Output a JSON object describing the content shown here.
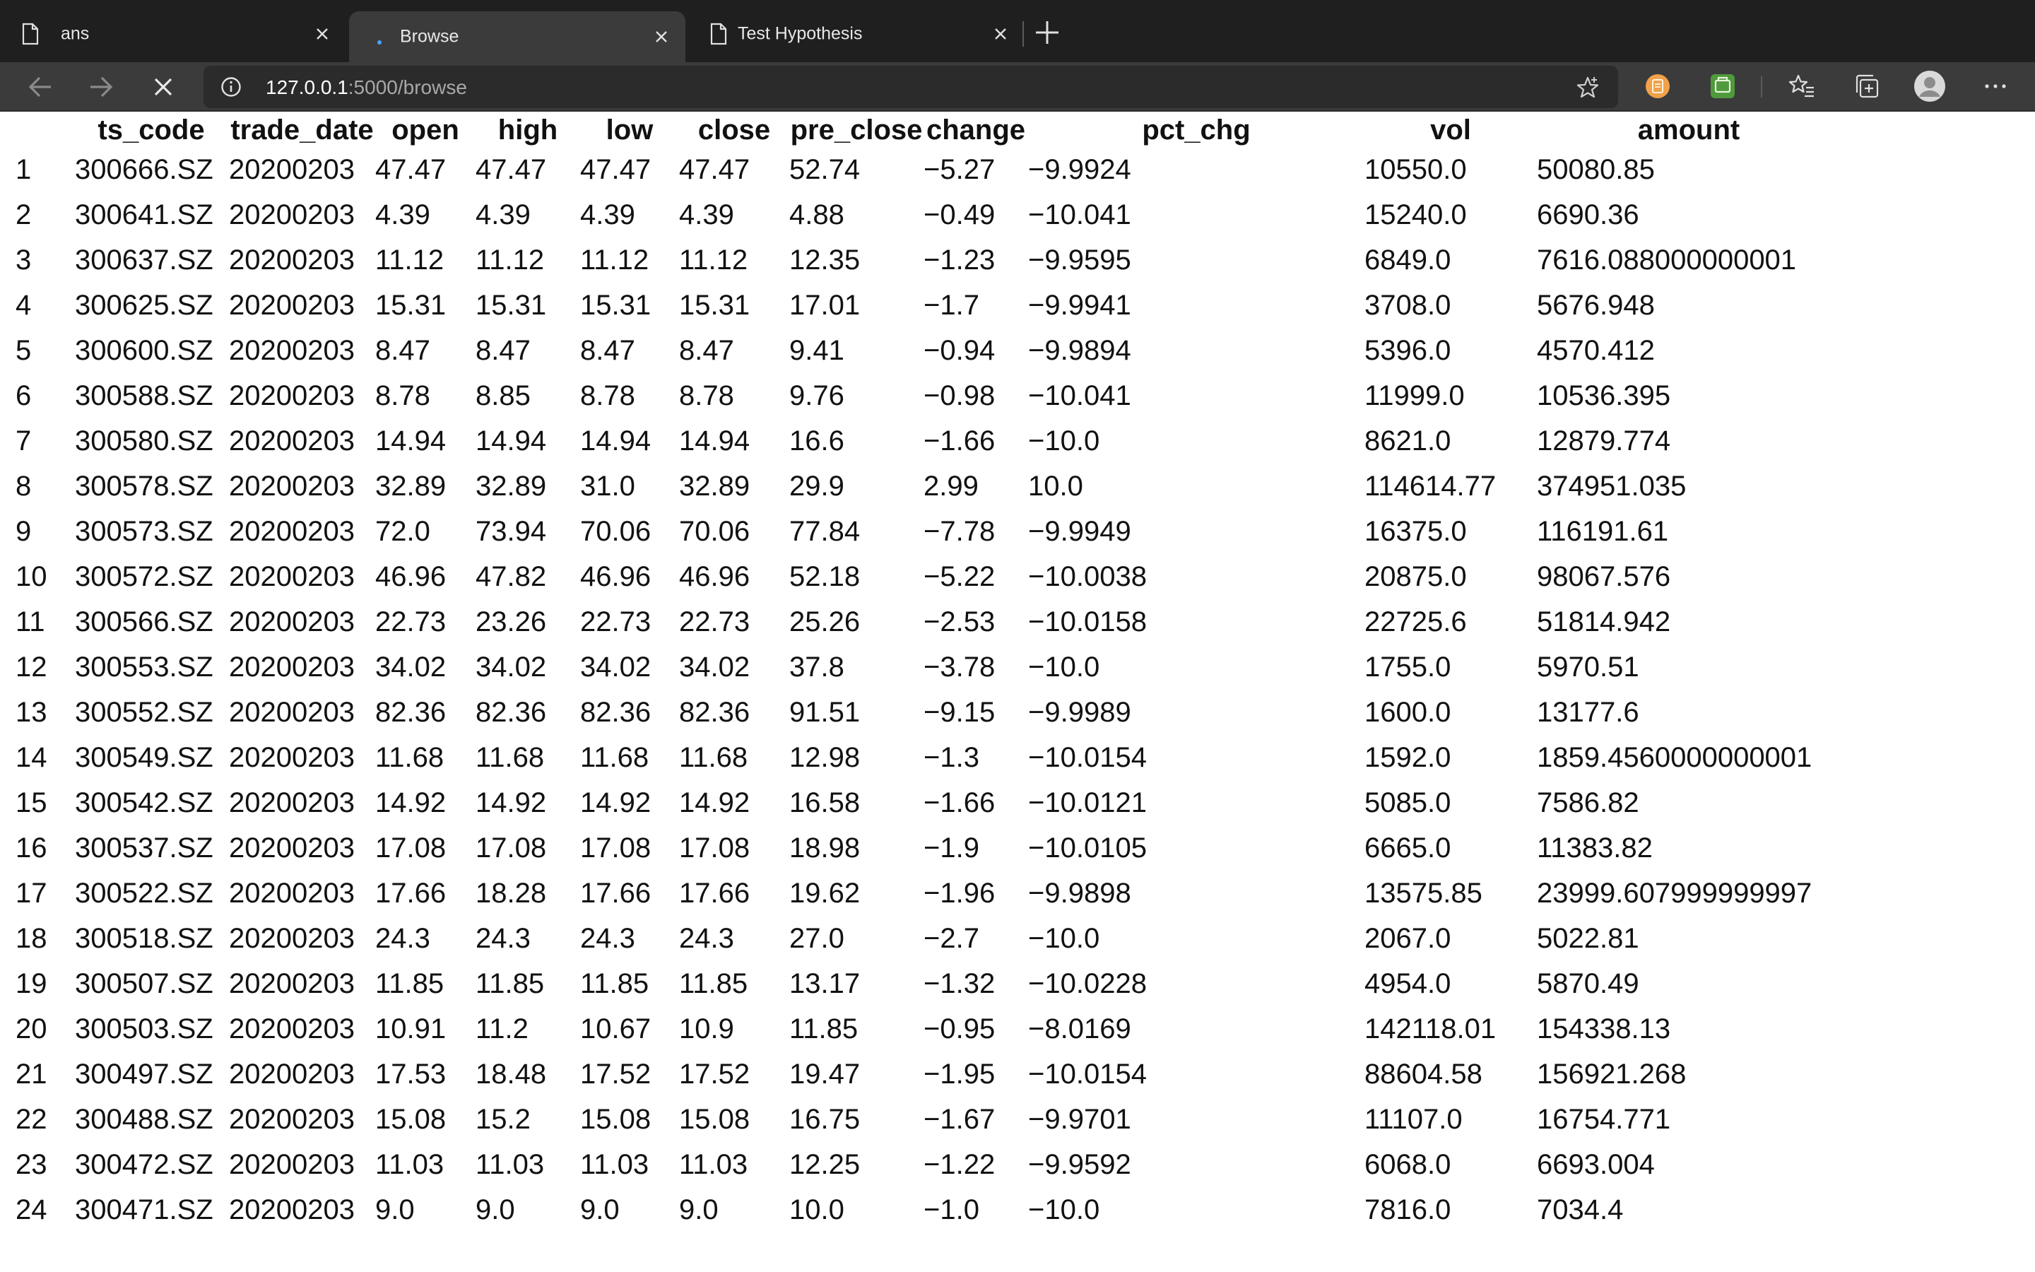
{
  "browser": {
    "tabs": [
      {
        "title": "ans",
        "active": false
      },
      {
        "title": "Browse",
        "active": true,
        "loading": true
      },
      {
        "title": "Test Hypothesis",
        "active": false
      }
    ],
    "address": {
      "host": "127.0.0.1",
      "rest": ":5000/browse"
    },
    "icons": [
      "back-icon",
      "forward-icon",
      "stop-loading-icon",
      "site-info-icon",
      "favorite-star-icon",
      "extension-orange-icon",
      "extension-green-icon",
      "favorites-icon",
      "collections-icon",
      "profile-avatar-icon",
      "more-menu-icon"
    ],
    "colors": {
      "tabstrip": "#1f1f1f",
      "toolbar": "#3b3b3b",
      "address_bg": "#2b2b2b"
    }
  },
  "table": {
    "columns": [
      "",
      "ts_code",
      "trade_date",
      "open",
      "high",
      "low",
      "close",
      "pre_close",
      "change",
      "pct_chg",
      "vol",
      "amount"
    ],
    "rows": [
      [
        "1",
        "300666.SZ",
        "20200203",
        "47.47",
        "47.47",
        "47.47",
        "47.47",
        "52.74",
        "−5.27",
        "−9.9924",
        "10550.0",
        "50080.85"
      ],
      [
        "2",
        "300641.SZ",
        "20200203",
        "4.39",
        "4.39",
        "4.39",
        "4.39",
        "4.88",
        "−0.49",
        "−10.041",
        "15240.0",
        "6690.36"
      ],
      [
        "3",
        "300637.SZ",
        "20200203",
        "11.12",
        "11.12",
        "11.12",
        "11.12",
        "12.35",
        "−1.23",
        "−9.9595",
        "6849.0",
        "7616.088000000001"
      ],
      [
        "4",
        "300625.SZ",
        "20200203",
        "15.31",
        "15.31",
        "15.31",
        "15.31",
        "17.01",
        "−1.7",
        "−9.9941",
        "3708.0",
        "5676.948"
      ],
      [
        "5",
        "300600.SZ",
        "20200203",
        "8.47",
        "8.47",
        "8.47",
        "8.47",
        "9.41",
        "−0.94",
        "−9.9894",
        "5396.0",
        "4570.412"
      ],
      [
        "6",
        "300588.SZ",
        "20200203",
        "8.78",
        "8.85",
        "8.78",
        "8.78",
        "9.76",
        "−0.98",
        "−10.041",
        "11999.0",
        "10536.395"
      ],
      [
        "7",
        "300580.SZ",
        "20200203",
        "14.94",
        "14.94",
        "14.94",
        "14.94",
        "16.6",
        "−1.66",
        "−10.0",
        "8621.0",
        "12879.774"
      ],
      [
        "8",
        "300578.SZ",
        "20200203",
        "32.89",
        "32.89",
        "31.0",
        "32.89",
        "29.9",
        "2.99",
        "10.0",
        "114614.77",
        "374951.035"
      ],
      [
        "9",
        "300573.SZ",
        "20200203",
        "72.0",
        "73.94",
        "70.06",
        "70.06",
        "77.84",
        "−7.78",
        "−9.9949",
        "16375.0",
        "116191.61"
      ],
      [
        "10",
        "300572.SZ",
        "20200203",
        "46.96",
        "47.82",
        "46.96",
        "46.96",
        "52.18",
        "−5.22",
        "−10.0038",
        "20875.0",
        "98067.576"
      ],
      [
        "11",
        "300566.SZ",
        "20200203",
        "22.73",
        "23.26",
        "22.73",
        "22.73",
        "25.26",
        "−2.53",
        "−10.0158",
        "22725.6",
        "51814.942"
      ],
      [
        "12",
        "300553.SZ",
        "20200203",
        "34.02",
        "34.02",
        "34.02",
        "34.02",
        "37.8",
        "−3.78",
        "−10.0",
        "1755.0",
        "5970.51"
      ],
      [
        "13",
        "300552.SZ",
        "20200203",
        "82.36",
        "82.36",
        "82.36",
        "82.36",
        "91.51",
        "−9.15",
        "−9.9989",
        "1600.0",
        "13177.6"
      ],
      [
        "14",
        "300549.SZ",
        "20200203",
        "11.68",
        "11.68",
        "11.68",
        "11.68",
        "12.98",
        "−1.3",
        "−10.0154",
        "1592.0",
        "1859.4560000000001"
      ],
      [
        "15",
        "300542.SZ",
        "20200203",
        "14.92",
        "14.92",
        "14.92",
        "14.92",
        "16.58",
        "−1.66",
        "−10.0121",
        "5085.0",
        "7586.82"
      ],
      [
        "16",
        "300537.SZ",
        "20200203",
        "17.08",
        "17.08",
        "17.08",
        "17.08",
        "18.98",
        "−1.9",
        "−10.0105",
        "6665.0",
        "11383.82"
      ],
      [
        "17",
        "300522.SZ",
        "20200203",
        "17.66",
        "18.28",
        "17.66",
        "17.66",
        "19.62",
        "−1.96",
        "−9.9898",
        "13575.85",
        "23999.607999999997"
      ],
      [
        "18",
        "300518.SZ",
        "20200203",
        "24.3",
        "24.3",
        "24.3",
        "24.3",
        "27.0",
        "−2.7",
        "−10.0",
        "2067.0",
        "5022.81"
      ],
      [
        "19",
        "300507.SZ",
        "20200203",
        "11.85",
        "11.85",
        "11.85",
        "11.85",
        "13.17",
        "−1.32",
        "−10.0228",
        "4954.0",
        "5870.49"
      ],
      [
        "20",
        "300503.SZ",
        "20200203",
        "10.91",
        "11.2",
        "10.67",
        "10.9",
        "11.85",
        "−0.95",
        "−8.0169",
        "142118.01",
        "154338.13"
      ],
      [
        "21",
        "300497.SZ",
        "20200203",
        "17.53",
        "18.48",
        "17.52",
        "17.52",
        "19.47",
        "−1.95",
        "−10.0154",
        "88604.58",
        "156921.268"
      ],
      [
        "22",
        "300488.SZ",
        "20200203",
        "15.08",
        "15.2",
        "15.08",
        "15.08",
        "16.75",
        "−1.67",
        "−9.9701",
        "11107.0",
        "16754.771"
      ],
      [
        "23",
        "300472.SZ",
        "20200203",
        "11.03",
        "11.03",
        "11.03",
        "11.03",
        "12.25",
        "−1.22",
        "−9.9592",
        "6068.0",
        "6693.004"
      ],
      [
        "24",
        "300471.SZ",
        "20200203",
        "9.0",
        "9.0",
        "9.0",
        "9.0",
        "10.0",
        "−1.0",
        "−10.0",
        "7816.0",
        "7034.4"
      ]
    ]
  }
}
